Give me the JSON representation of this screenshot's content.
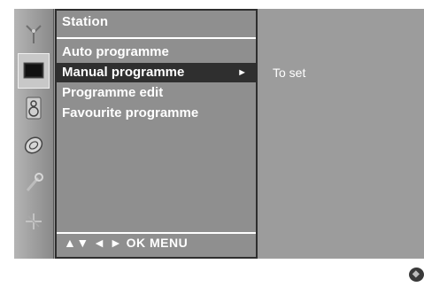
{
  "menu": {
    "title": "Station",
    "items": [
      {
        "label": "Auto programme"
      },
      {
        "label": "Manual programme",
        "arrow": "►"
      },
      {
        "label": "Programme edit"
      },
      {
        "label": "Favourite programme"
      }
    ],
    "nav_hint": "▲▼  ◄ ►  OK  MENU"
  },
  "side_icons": [
    {
      "name": "antenna-icon"
    },
    {
      "name": "tv-screen-icon",
      "active": true
    },
    {
      "name": "speaker-icon"
    },
    {
      "name": "clock-icon"
    },
    {
      "name": "wrench-icon"
    },
    {
      "name": "input-connector-icon"
    }
  ],
  "right_panel": {
    "text": "To set"
  },
  "colors": {
    "menu_bg": "#8f8f8f",
    "selected_bg": "#2f2f2f",
    "text": "#ffffff"
  }
}
